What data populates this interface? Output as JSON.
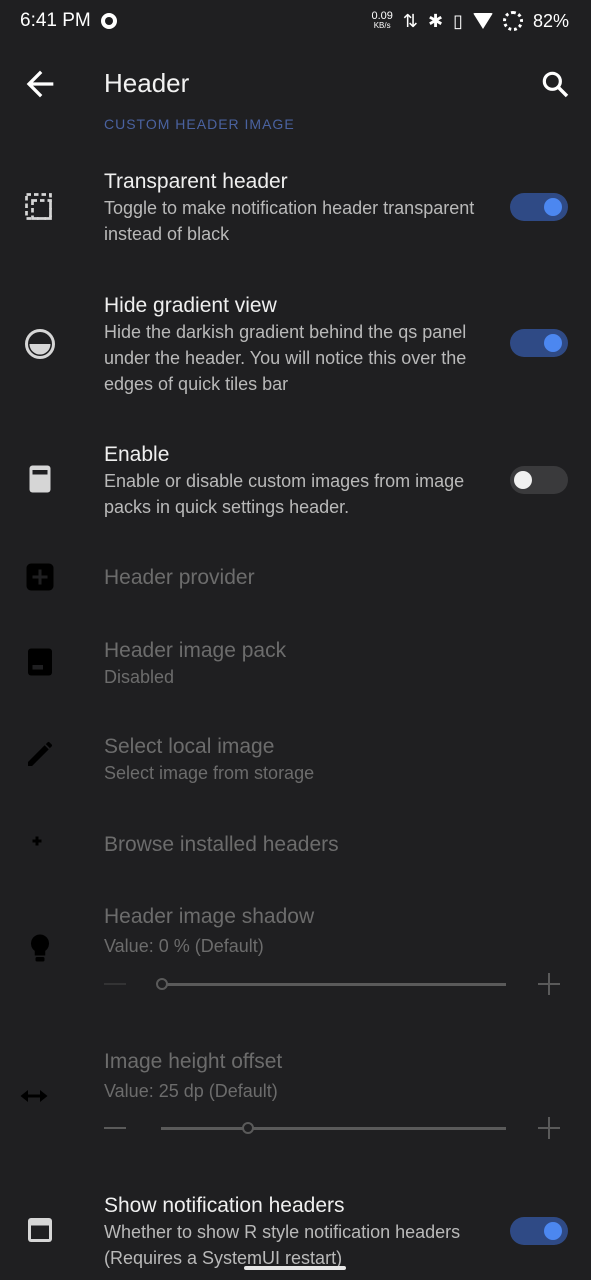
{
  "status": {
    "time": "6:41 PM",
    "speed_value": "0.09",
    "speed_unit": "KB/s",
    "battery": "82%"
  },
  "toolbar": {
    "title": "Header"
  },
  "section": {
    "label": "CUSTOM HEADER IMAGE"
  },
  "items": [
    {
      "title": "Transparent header",
      "subtitle": "Toggle to make notification header transparent instead of black",
      "switch": "on"
    },
    {
      "title": "Hide gradient view",
      "subtitle": "Hide the darkish gradient behind the qs panel under the header. You will notice this over the edges of quick tiles bar",
      "switch": "on"
    },
    {
      "title": "Enable",
      "subtitle": "Enable or disable custom images from image packs in quick settings header.",
      "switch": "off"
    },
    {
      "title": "Header provider"
    },
    {
      "title": "Header image pack",
      "subtitle": "Disabled"
    },
    {
      "title": "Select local image",
      "subtitle": "Select image from storage"
    },
    {
      "title": "Browse installed headers"
    },
    {
      "title": "Header image shadow",
      "subtitle": "Value: 0 % (Default)",
      "slider_value": 0
    },
    {
      "title": "Image height offset",
      "subtitle": "Value: 25 dp (Default)",
      "slider_value": 25
    },
    {
      "title": "Show notification headers",
      "subtitle": "Whether to show R style notification headers (Requires a SystemUI restart)",
      "switch": "on"
    }
  ],
  "colors": {
    "background": "#1f1f21",
    "accent": "#4c87f0",
    "section": "#5d7fd6"
  }
}
